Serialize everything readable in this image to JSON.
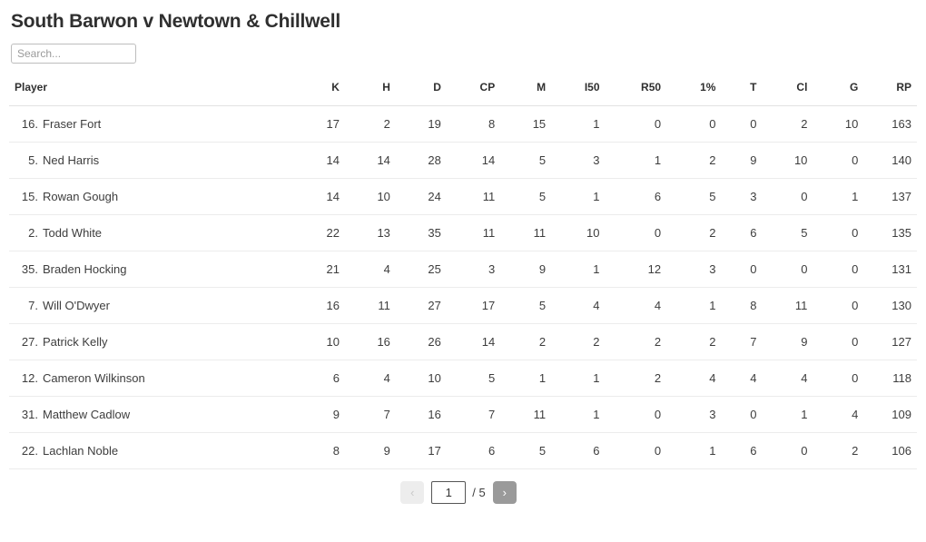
{
  "header": {
    "title": "South Barwon v Newtown & Chillwell"
  },
  "search": {
    "value": "",
    "placeholder": "Search..."
  },
  "table": {
    "columns": [
      "Player",
      "K",
      "H",
      "D",
      "CP",
      "M",
      "I50",
      "R50",
      "1%",
      "T",
      "Cl",
      "G",
      "RP"
    ],
    "rows": [
      {
        "number": "16.",
        "name": "Fraser Fort",
        "stats": [
          17,
          2,
          19,
          8,
          15,
          1,
          0,
          0,
          0,
          2,
          10,
          163
        ]
      },
      {
        "number": "5.",
        "name": "Ned Harris",
        "stats": [
          14,
          14,
          28,
          14,
          5,
          3,
          1,
          2,
          9,
          10,
          0,
          140
        ]
      },
      {
        "number": "15.",
        "name": "Rowan Gough",
        "stats": [
          14,
          10,
          24,
          11,
          5,
          1,
          6,
          5,
          3,
          0,
          1,
          137
        ]
      },
      {
        "number": "2.",
        "name": "Todd White",
        "stats": [
          22,
          13,
          35,
          11,
          11,
          10,
          0,
          2,
          6,
          5,
          0,
          135
        ]
      },
      {
        "number": "35.",
        "name": "Braden Hocking",
        "stats": [
          21,
          4,
          25,
          3,
          9,
          1,
          12,
          3,
          0,
          0,
          0,
          131
        ]
      },
      {
        "number": "7.",
        "name": "Will O'Dwyer",
        "stats": [
          16,
          11,
          27,
          17,
          5,
          4,
          4,
          1,
          8,
          11,
          0,
          130
        ]
      },
      {
        "number": "27.",
        "name": "Patrick Kelly",
        "stats": [
          10,
          16,
          26,
          14,
          2,
          2,
          2,
          2,
          7,
          9,
          0,
          127
        ]
      },
      {
        "number": "12.",
        "name": "Cameron Wilkinson",
        "stats": [
          6,
          4,
          10,
          5,
          1,
          1,
          2,
          4,
          4,
          4,
          0,
          118
        ]
      },
      {
        "number": "31.",
        "name": "Matthew Cadlow",
        "stats": [
          9,
          7,
          16,
          7,
          11,
          1,
          0,
          3,
          0,
          1,
          4,
          109
        ]
      },
      {
        "number": "22.",
        "name": "Lachlan Noble",
        "stats": [
          8,
          9,
          17,
          6,
          5,
          6,
          0,
          1,
          6,
          0,
          2,
          106
        ]
      }
    ]
  },
  "pagination": {
    "prev_label": "‹",
    "next_label": "›",
    "current_page": "1",
    "total_label": "/ 5"
  }
}
